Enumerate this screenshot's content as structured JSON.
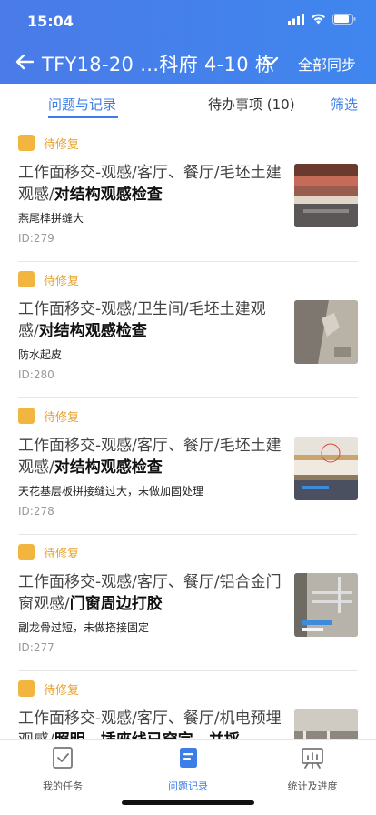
{
  "status_bar": {
    "time": "15:04"
  },
  "nav": {
    "title": "TFY18-20 …科府 4-10 栋",
    "sync_label": "全部同步"
  },
  "tabs": {
    "issues_label": "问题与记录",
    "todo_label": "待办事项 (10)",
    "filter_label": "筛选"
  },
  "records": [
    {
      "status": "待修复",
      "title_plain": "工作面移交-观感/客厅、餐厅/毛坯土建观感/",
      "title_bold": "对结构观感检查",
      "desc": "燕尾榫拼缝大",
      "id": "ID:279"
    },
    {
      "status": "待修复",
      "title_plain": "工作面移交-观感/卫生间/毛坯土建观感/",
      "title_bold": "对结构观感检查",
      "desc": "防水起皮",
      "id": "ID:280"
    },
    {
      "status": "待修复",
      "title_plain": "工作面移交-观感/客厅、餐厅/毛坯土建观感/",
      "title_bold": "对结构观感检查",
      "desc": "天花基层板拼接缝过大，未做加固处理",
      "id": "ID:278"
    },
    {
      "status": "待修复",
      "title_plain": "工作面移交-观感/客厅、餐厅/铝合金门窗观感/",
      "title_bold": "门窗周边打胶",
      "desc": "副龙骨过短，未做搭接固定",
      "id": "ID:277"
    },
    {
      "status": "待修复",
      "title_plain": "工作面移交-观感/客厅、餐厅/机电预埋观感/",
      "title_bold": "照明、插座线已穿完，并採",
      "desc": "",
      "id": ""
    }
  ],
  "tabbar": {
    "tasks_label": "我的任务",
    "issues_label": "问题记录",
    "stats_label": "统计及进度"
  },
  "colors": {
    "primary": "#3d7de8",
    "status_pending": "#f2b540"
  }
}
